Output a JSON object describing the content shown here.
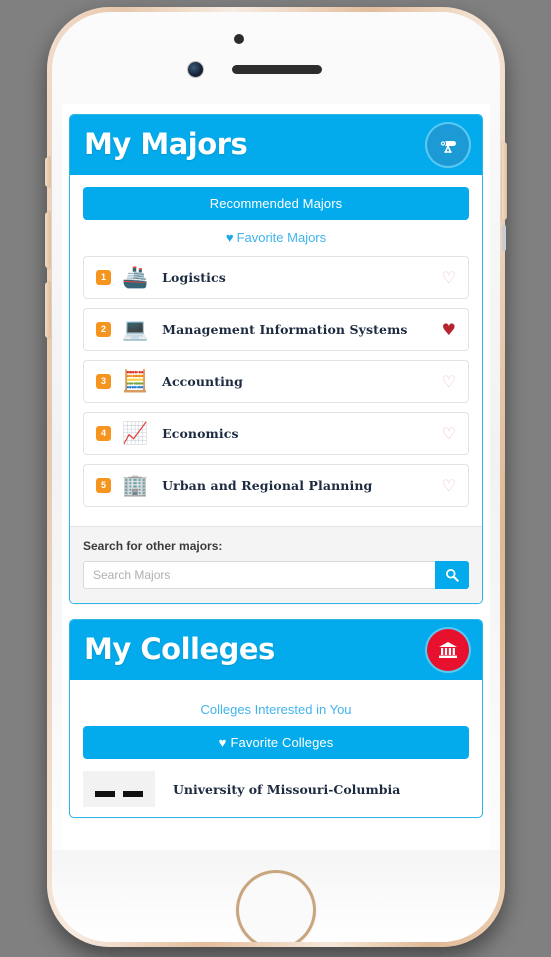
{
  "device": {
    "type": "smartphone-mockup",
    "frame_color": "#e7c7ab",
    "body_color": "#fbfbfb"
  },
  "theme": {
    "accent_blue": "#03ABEC",
    "border_blue": "#2cb6e8",
    "badge_orange": "#F5941E",
    "heart_filled": "#B5252F",
    "heart_outline": "#f2bdbd",
    "college_icon_red": "#E8112D",
    "link_blue": "#3fb4ec"
  },
  "majors_panel": {
    "title": "My Majors",
    "header_icon": "diploma-scroll-icon",
    "tabs": {
      "recommended_label": "Recommended Majors",
      "favorite_label": "Favorite Majors",
      "favorite_icon": "heart-icon",
      "active": "recommended"
    },
    "majors": [
      {
        "rank": "1",
        "emoji": "🚢",
        "icon_name": "cargo-ship-icon",
        "name": "Logistics",
        "favorited": false
      },
      {
        "rank": "2",
        "emoji": "💻",
        "icon_name": "computer-team-icon",
        "name": "Management Information Systems",
        "favorited": true
      },
      {
        "rank": "3",
        "emoji": "🧮",
        "icon_name": "calculator-icon",
        "name": "Accounting",
        "favorited": false
      },
      {
        "rank": "4",
        "emoji": "📈",
        "icon_name": "chart-monitor-icon",
        "name": "Economics",
        "favorited": false
      },
      {
        "rank": "5",
        "emoji": "🏢",
        "icon_name": "office-building-icon",
        "name": "Urban and Regional Planning",
        "favorited": false
      }
    ],
    "search": {
      "label": "Search for other majors:",
      "placeholder": "Search Majors",
      "value": "",
      "button_icon": "search-icon"
    }
  },
  "colleges_panel": {
    "title": "My Colleges",
    "header_icon": "university-building-icon",
    "tabs": {
      "interested_label": "Colleges Interested in You",
      "favorite_label": "Favorite Colleges",
      "favorite_icon": "heart-icon",
      "active": "favorite"
    },
    "colleges": [
      {
        "name": "University of Missouri-Columbia",
        "logo_name": "college-logo"
      }
    ]
  }
}
